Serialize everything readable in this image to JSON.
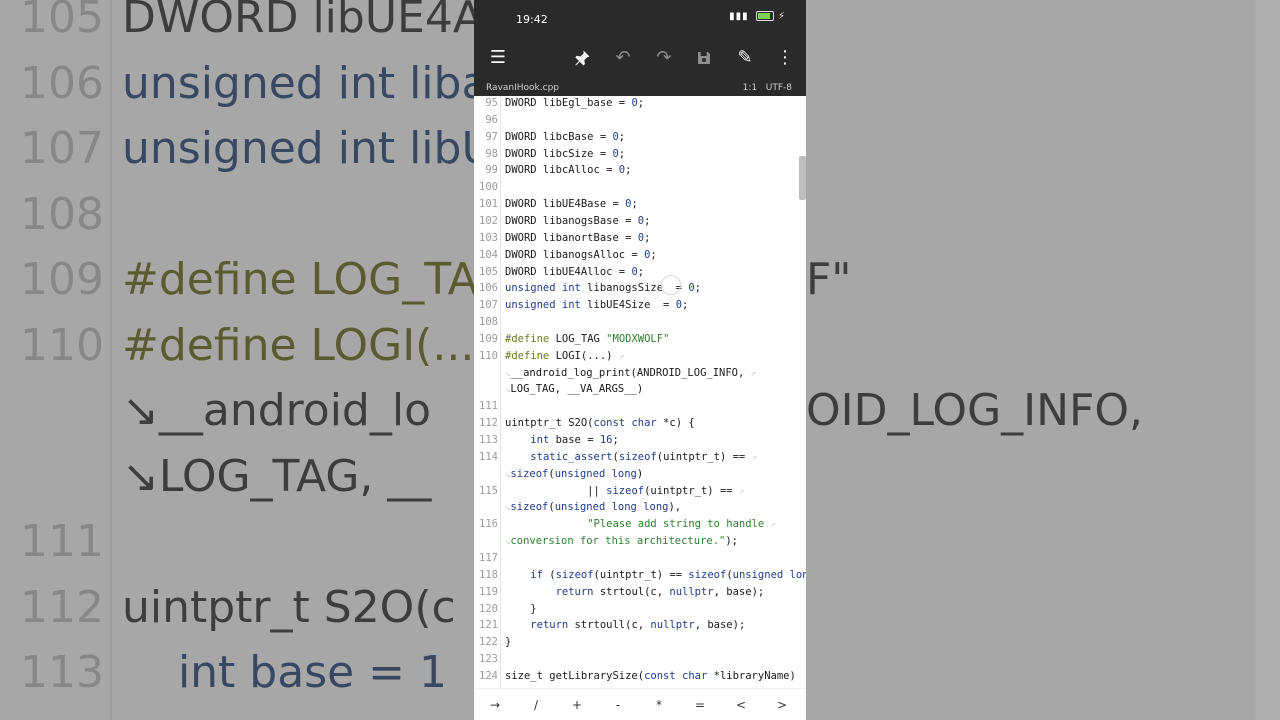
{
  "background": {
    "lines": [
      {
        "num": "105",
        "code": "DWORD libUE4A",
        "kind": "plain"
      },
      {
        "num": "106",
        "code": "unsigned int liba",
        "kind": "kw"
      },
      {
        "num": "107",
        "code": "unsigned int libU",
        "kind": "kw"
      },
      {
        "num": "108",
        "code": "",
        "kind": "plain"
      },
      {
        "num": "109",
        "code": "#define LOG_TA",
        "kind": "pp",
        "right": "F\""
      },
      {
        "num": "110",
        "code": "#define LOGI(...)",
        "kind": "pp"
      },
      {
        "num": "",
        "code": "↘__android_lo",
        "kind": "plain",
        "right": "OID_LOG_INFO,"
      },
      {
        "num": "",
        "code": "↘LOG_TAG, __",
        "kind": "plain"
      },
      {
        "num": "111",
        "code": "",
        "kind": "plain"
      },
      {
        "num": "112",
        "code": "uintptr_t S2O(c",
        "kind": "plain"
      },
      {
        "num": "113",
        "code": "    int base = 1",
        "kind": "kw"
      }
    ]
  },
  "status": {
    "time": "19:42",
    "icons": "☠ .∙ıl",
    "battery_level": 0.84
  },
  "toolbar": {
    "menu_icon": "☰",
    "pin_icon": "📌",
    "undo_icon": "↶",
    "redo_icon": "↷",
    "save_icon": "💾",
    "edit_icon": "✎",
    "more_icon": "⋮"
  },
  "file": {
    "name": "RavanIHook.cpp",
    "position": "1:1",
    "encoding": "UTF-8"
  },
  "editor": {
    "lines": [
      {
        "ln": "95",
        "parts": [
          [
            "plain",
            "DWORD libEgl_base = "
          ],
          [
            "num",
            "0"
          ],
          [
            "plain",
            ";"
          ]
        ]
      },
      {
        "ln": "96",
        "parts": []
      },
      {
        "ln": "97",
        "parts": [
          [
            "plain",
            "DWORD libcBase = "
          ],
          [
            "num",
            "0"
          ],
          [
            "plain",
            ";"
          ]
        ]
      },
      {
        "ln": "98",
        "parts": [
          [
            "plain",
            "DWORD libcSize = "
          ],
          [
            "num",
            "0"
          ],
          [
            "plain",
            ";"
          ]
        ]
      },
      {
        "ln": "99",
        "parts": [
          [
            "plain",
            "DWORD libcAlloc = "
          ],
          [
            "num",
            "0"
          ],
          [
            "plain",
            ";"
          ]
        ]
      },
      {
        "ln": "100",
        "parts": []
      },
      {
        "ln": "101",
        "parts": [
          [
            "plain",
            "DWORD libUE4Base = "
          ],
          [
            "num",
            "0"
          ],
          [
            "plain",
            ";"
          ]
        ]
      },
      {
        "ln": "102",
        "parts": [
          [
            "plain",
            "DWORD libanogsBase = "
          ],
          [
            "num",
            "0"
          ],
          [
            "plain",
            ";"
          ]
        ]
      },
      {
        "ln": "103",
        "parts": [
          [
            "plain",
            "DWORD libanortBase = "
          ],
          [
            "num",
            "0"
          ],
          [
            "plain",
            ";"
          ]
        ]
      },
      {
        "ln": "104",
        "parts": [
          [
            "plain",
            "DWORD libanogsAlloc = "
          ],
          [
            "num",
            "0"
          ],
          [
            "plain",
            ";"
          ]
        ]
      },
      {
        "ln": "105",
        "parts": [
          [
            "plain",
            "DWORD libUE4Alloc = "
          ],
          [
            "num",
            "0"
          ],
          [
            "plain",
            ";"
          ]
        ]
      },
      {
        "ln": "106",
        "parts": [
          [
            "kw",
            "unsigned int"
          ],
          [
            "plain",
            " libanogsSize  = "
          ],
          [
            "num",
            "0"
          ],
          [
            "plain",
            ";"
          ]
        ]
      },
      {
        "ln": "107",
        "parts": [
          [
            "kw",
            "unsigned int"
          ],
          [
            "plain",
            " libUE4Size  = "
          ],
          [
            "num",
            "0"
          ],
          [
            "plain",
            ";"
          ]
        ]
      },
      {
        "ln": "108",
        "parts": []
      },
      {
        "ln": "109",
        "parts": [
          [
            "pp",
            "#define"
          ],
          [
            "plain",
            " LOG_TAG "
          ],
          [
            "str",
            "\"MODXWOLF\""
          ]
        ]
      },
      {
        "ln": "110",
        "parts": [
          [
            "pp",
            "#define"
          ],
          [
            "plain",
            " LOGI(...) "
          ],
          [
            "wrap",
            "↗"
          ]
        ]
      },
      {
        "ln": "",
        "parts": [
          [
            "wrap",
            "↘"
          ],
          [
            "plain",
            "__android_log_print(ANDROID_LOG_INFO, "
          ],
          [
            "wrap",
            "↗"
          ]
        ]
      },
      {
        "ln": "",
        "parts": [
          [
            "wrap",
            "↘"
          ],
          [
            "plain",
            "LOG_TAG, __VA_ARGS__)"
          ]
        ]
      },
      {
        "ln": "111",
        "parts": []
      },
      {
        "ln": "112",
        "parts": [
          [
            "plain",
            "uintptr_t S2O("
          ],
          [
            "kw",
            "const char"
          ],
          [
            "plain",
            " *c) {"
          ]
        ]
      },
      {
        "ln": "113",
        "parts": [
          [
            "plain",
            "    "
          ],
          [
            "kw",
            "int"
          ],
          [
            "plain",
            " base = "
          ],
          [
            "num",
            "16"
          ],
          [
            "plain",
            ";"
          ]
        ]
      },
      {
        "ln": "114",
        "parts": [
          [
            "plain",
            "    "
          ],
          [
            "kw",
            "static_assert"
          ],
          [
            "plain",
            "("
          ],
          [
            "kw",
            "sizeof"
          ],
          [
            "plain",
            "(uintptr_t) == "
          ],
          [
            "wrap",
            "↗"
          ]
        ]
      },
      {
        "ln": "",
        "parts": [
          [
            "wrap",
            "↘"
          ],
          [
            "kw",
            "sizeof"
          ],
          [
            "plain",
            "("
          ],
          [
            "kw",
            "unsigned long"
          ],
          [
            "plain",
            ")"
          ]
        ]
      },
      {
        "ln": "115",
        "parts": [
          [
            "plain",
            "             || "
          ],
          [
            "kw",
            "sizeof"
          ],
          [
            "plain",
            "(uintptr_t) == "
          ],
          [
            "wrap",
            "↗"
          ]
        ]
      },
      {
        "ln": "",
        "parts": [
          [
            "wrap",
            "↘"
          ],
          [
            "kw",
            "sizeof"
          ],
          [
            "plain",
            "("
          ],
          [
            "kw",
            "unsigned long long"
          ],
          [
            "plain",
            "),"
          ]
        ]
      },
      {
        "ln": "116",
        "parts": [
          [
            "plain",
            "             "
          ],
          [
            "str",
            "\"Please add string to handle "
          ],
          [
            "wrap",
            "↗"
          ]
        ]
      },
      {
        "ln": "",
        "parts": [
          [
            "wrap",
            "↘"
          ],
          [
            "str",
            "conversion for this architecture.\""
          ],
          [
            "plain",
            ");"
          ]
        ]
      },
      {
        "ln": "117",
        "parts": []
      },
      {
        "ln": "118",
        "parts": [
          [
            "plain",
            "    "
          ],
          [
            "kw",
            "if"
          ],
          [
            "plain",
            " ("
          ],
          [
            "kw",
            "sizeof"
          ],
          [
            "plain",
            "(uintptr_t) == "
          ],
          [
            "kw",
            "sizeof"
          ],
          [
            "plain",
            "("
          ],
          [
            "kw",
            "unsigned long"
          ],
          [
            "plain",
            ")) {"
          ]
        ]
      },
      {
        "ln": "119",
        "parts": [
          [
            "plain",
            "        "
          ],
          [
            "kw",
            "return"
          ],
          [
            "plain",
            " strtoul(c, "
          ],
          [
            "kw",
            "nullptr"
          ],
          [
            "plain",
            ", base);"
          ]
        ]
      },
      {
        "ln": "120",
        "parts": [
          [
            "plain",
            "    }"
          ]
        ]
      },
      {
        "ln": "121",
        "parts": [
          [
            "plain",
            "    "
          ],
          [
            "kw",
            "return"
          ],
          [
            "plain",
            " strtoull(c, "
          ],
          [
            "kw",
            "nullptr"
          ],
          [
            "plain",
            ", base);"
          ]
        ]
      },
      {
        "ln": "122",
        "parts": [
          [
            "plain",
            "}"
          ]
        ]
      },
      {
        "ln": "123",
        "parts": []
      },
      {
        "ln": "124",
        "parts": [
          [
            "plain",
            "size_t getLibrarySize("
          ],
          [
            "kw",
            "const char"
          ],
          [
            "plain",
            " *libraryName)"
          ]
        ]
      }
    ]
  },
  "keys": [
    "→",
    "/",
    "+",
    "-",
    "*",
    "=",
    "<",
    ">"
  ]
}
